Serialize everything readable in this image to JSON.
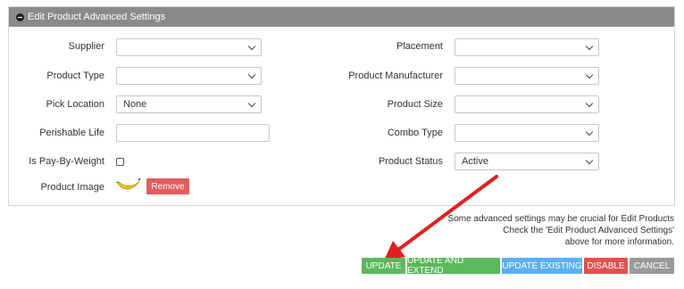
{
  "panel": {
    "title": "Edit Product Advanced Settings"
  },
  "left_fields": {
    "supplier": {
      "label": "Supplier",
      "value": ""
    },
    "product_type": {
      "label": "Product Type",
      "value": ""
    },
    "pick_location": {
      "label": "Pick Location",
      "value": "None"
    },
    "perishable_life": {
      "label": "Perishable Life",
      "value": ""
    },
    "pay_by_weight": {
      "label": "Is Pay-By-Weight",
      "checked": false
    },
    "product_image": {
      "label": "Product Image",
      "remove_label": "Remove",
      "image": "banana-image"
    }
  },
  "right_fields": {
    "placement": {
      "label": "Placement",
      "value": ""
    },
    "manufacturer": {
      "label": "Product Manufacturer",
      "value": ""
    },
    "size": {
      "label": "Product Size",
      "value": ""
    },
    "combo_type": {
      "label": "Combo Type",
      "value": ""
    },
    "status": {
      "label": "Product Status",
      "value": "Active"
    }
  },
  "note": {
    "line1": "Some advanced settings may be crucial for Edit Products",
    "line2": "Check the 'Edit Product Advanced Settings'",
    "line3": "above for more information."
  },
  "actions": {
    "update": "UPDATE",
    "update_extend": "UPDATE AND EXTEND",
    "update_existing": "UPDATE EXISTING",
    "disable": "DISABLE",
    "cancel": "CANCEL"
  },
  "colors": {
    "header": "#8a8a8a",
    "green": "#5cb85c",
    "blue": "#5bb0f2",
    "red": "#e25050",
    "gray": "#9a9a9a",
    "arrow": "#e0201e"
  }
}
